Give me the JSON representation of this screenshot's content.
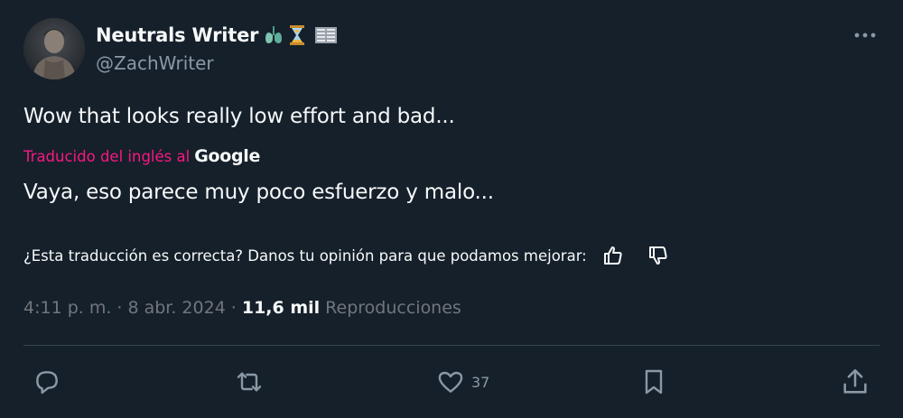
{
  "author": {
    "display_name": "Neutrals Writer",
    "handle": "@ZachWriter",
    "badges": [
      "lungs-emoji",
      "hourglass-emoji",
      "book-emoji"
    ]
  },
  "tweet": {
    "text": "Wow that looks really low effort and bad...",
    "translation": {
      "label": "Traducido del inglés al",
      "provider": "Google",
      "text": "Vaya, eso parece muy poco esfuerzo y malo..."
    },
    "feedback_prompt": "¿Esta traducción es correcta? Danos tu opinión para que podamos mejorar:",
    "time": "4:11 p. m.",
    "date": "8 abr. 2024",
    "separator": "·",
    "views_count": "11,6 mil",
    "views_label": "Reproducciones"
  },
  "actions": {
    "reply": {
      "icon": "reply-icon",
      "count": ""
    },
    "retweet": {
      "icon": "retweet-icon",
      "count": ""
    },
    "like": {
      "icon": "heart-icon",
      "count": "37"
    },
    "bookmark": {
      "icon": "bookmark-icon",
      "count": ""
    },
    "share": {
      "icon": "share-icon",
      "count": ""
    }
  },
  "colors": {
    "background": "#15202b",
    "text_primary": "#f7f9f9",
    "text_secondary": "#8b98a5",
    "translation_accent": "#f91880",
    "divider": "#38444d"
  }
}
